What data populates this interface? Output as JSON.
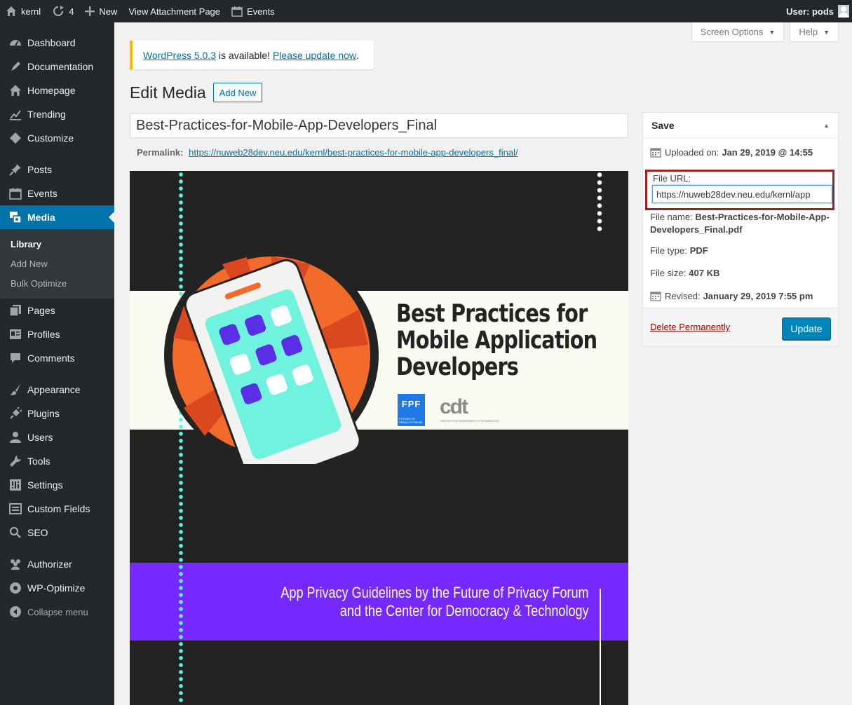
{
  "adminbar": {
    "site_name": "kernl",
    "updates_count": "4",
    "new_label": "New",
    "view_label": "View Attachment Page",
    "events_label": "Events",
    "user_label": "User: pods"
  },
  "sidebar": {
    "items": [
      {
        "label": "Dashboard",
        "icon": "dashboard-icon"
      },
      {
        "label": "Documentation",
        "icon": "documentation-icon"
      },
      {
        "label": "Homepage",
        "icon": "home-icon"
      },
      {
        "label": "Trending",
        "icon": "trending-icon"
      },
      {
        "label": "Customize",
        "icon": "customize-icon"
      },
      {
        "label": "Posts",
        "icon": "pin-icon"
      },
      {
        "label": "Events",
        "icon": "calendar-icon"
      },
      {
        "label": "Media",
        "icon": "media-icon"
      },
      {
        "label": "Pages",
        "icon": "pages-icon"
      },
      {
        "label": "Profiles",
        "icon": "profiles-icon"
      },
      {
        "label": "Comments",
        "icon": "comments-icon"
      },
      {
        "label": "Appearance",
        "icon": "brush-icon"
      },
      {
        "label": "Plugins",
        "icon": "plugin-icon"
      },
      {
        "label": "Users",
        "icon": "users-icon"
      },
      {
        "label": "Tools",
        "icon": "wrench-icon"
      },
      {
        "label": "Settings",
        "icon": "settings-icon"
      },
      {
        "label": "Custom Fields",
        "icon": "fields-icon"
      },
      {
        "label": "SEO",
        "icon": "search-icon"
      },
      {
        "label": "Authorizer",
        "icon": "authorizer-icon"
      },
      {
        "label": "WP-Optimize",
        "icon": "optimize-icon"
      }
    ],
    "submenu": [
      "Library",
      "Add New",
      "Bulk Optimize"
    ],
    "collapse_label": "Collapse menu"
  },
  "screen_meta": {
    "screen_options": "Screen Options",
    "help": "Help"
  },
  "notice": {
    "version_link": "WordPress 5.0.3",
    "middle": " is available! ",
    "update_link": "Please update now",
    "end": "."
  },
  "heading": {
    "title": "Edit Media",
    "add_new": "Add New"
  },
  "title_field": {
    "value": "Best-Practices-for-Mobile-App-Developers_Final"
  },
  "permalink": {
    "label": "Permalink:",
    "url": "https://nuweb28dev.neu.edu/kernl/best-practices-for-mobile-app-developers_final/"
  },
  "preview": {
    "title_lines": [
      "Best Practices for",
      "Mobile Application",
      "Developers"
    ],
    "fpf_logo": "FPF",
    "fpf_small": "FUTURE OF PRIVACY FORUM",
    "cdt_logo": "cdt",
    "cdt_small": "CENTER FOR DEMOCRACY & TECHNOLOGY",
    "subtitle_lines": [
      "App Privacy Guidelines by the Future of Privacy Forum",
      "and the Center for Democracy & Technology"
    ],
    "colors": {
      "dark": "#232323",
      "band": "#fbfbf3",
      "purple": "#7629ff",
      "teal": "#5ef2de",
      "orange": "#f26b2a"
    }
  },
  "save_box": {
    "title": "Save",
    "uploaded_label": "Uploaded on:",
    "uploaded_value": "Jan 29, 2019 @ 14:55",
    "file_url_label": "File URL:",
    "file_url_value": "https://nuweb28dev.neu.edu/kernl/app",
    "file_name_label": "File name:",
    "file_name_value": "Best-Practices-for-Mobile-App-Developers_Final.pdf",
    "file_type_label": "File type:",
    "file_type_value": "PDF",
    "file_size_label": "File size:",
    "file_size_value": "407 KB",
    "revised_label": "Revised:",
    "revised_value": "January 29, 2019 7:55 pm",
    "delete_label": "Delete Permanently",
    "update_label": "Update"
  },
  "accent_colors": {
    "wp_blue": "#0073aa",
    "highlight_red": "#a51d1d",
    "nag_yellow": "#ffb900"
  }
}
